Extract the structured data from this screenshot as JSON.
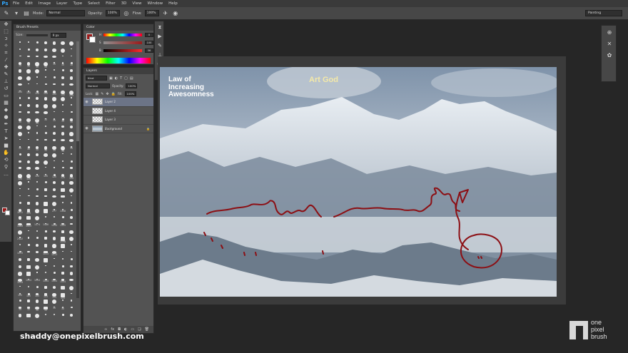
{
  "app": {
    "logo": "Ps"
  },
  "menu": [
    "File",
    "Edit",
    "Image",
    "Layer",
    "Type",
    "Select",
    "Filter",
    "3D",
    "View",
    "Window",
    "Help"
  ],
  "options": {
    "mode_label": "Mode:",
    "mode_value": "Normal",
    "opacity_label": "Opacity:",
    "opacity_value": "100%",
    "flow_label": "Flow:",
    "flow_value": "100%",
    "workspace": "Painting"
  },
  "brush_panel": {
    "tab": "Brush Presets",
    "size_label": "Size:",
    "size_value": "9 px",
    "rows": [
      [
        "",
        "",
        "",
        "",
        "",
        "",
        ""
      ],
      [
        "",
        "",
        "",
        "",
        "",
        "",
        ""
      ],
      [
        "",
        "",
        "",
        "",
        "",
        "",
        ""
      ],
      [
        "10",
        "10",
        "10",
        "10",
        "10",
        "10",
        "10"
      ],
      [
        "",
        "",
        "",
        "",
        "",
        "",
        ""
      ],
      [
        "",
        "",
        "",
        "",
        "",
        "",
        ""
      ],
      [
        "",
        "",
        "",
        "",
        "",
        "",
        ""
      ],
      [
        "100",
        "100",
        "100",
        "100",
        "100",
        "100",
        "100"
      ],
      [
        "",
        "",
        "",
        "",
        "",
        "",
        ""
      ],
      [
        "",
        "",
        "",
        "",
        "",
        "",
        ""
      ],
      [
        "",
        "",
        "",
        "",
        "",
        "",
        ""
      ],
      [
        "30",
        "30",
        "30",
        "30",
        "30",
        "30",
        "30"
      ],
      [
        "",
        "",
        "",
        "",
        "",
        "",
        ""
      ],
      [
        "",
        "",
        "",
        "",
        "",
        "",
        ""
      ],
      [
        "",
        "",
        "",
        "",
        "",
        "",
        ""
      ],
      [
        "30",
        "30",
        "30",
        "30",
        "30",
        "30",
        "30"
      ],
      [
        "",
        "",
        "",
        "",
        "",
        "",
        ""
      ],
      [
        "",
        "",
        "",
        "",
        "",
        "",
        ""
      ],
      [
        "",
        "",
        "",
        "",
        "",
        "",
        ""
      ],
      [
        "120",
        "120",
        "120",
        "120",
        "120",
        "120",
        "120"
      ],
      [
        "",
        "",
        "",
        "",
        "",
        "",
        ""
      ],
      [
        "",
        "",
        "",
        "",
        "",
        "",
        ""
      ],
      [
        "",
        "",
        "",
        "",
        "",
        "",
        ""
      ],
      [
        "",
        "",
        "",
        "",
        "",
        "",
        ""
      ],
      [
        "1651",
        "325",
        "",
        "",
        "277",
        "1448",
        ""
      ],
      [
        "",
        "",
        "",
        "",
        "",
        "",
        ""
      ],
      [
        "1469",
        "1413",
        "1474",
        "1486",
        "1450",
        "1445",
        ""
      ],
      [
        "",
        "",
        "",
        "",
        "",
        "",
        ""
      ],
      [
        "2422",
        "",
        "",
        "",
        "",
        "2098",
        ""
      ],
      [
        "",
        "",
        "",
        "",
        "",
        "",
        ""
      ],
      [
        "1013",
        "",
        "",
        "1013",
        "1013",
        "",
        ""
      ],
      [
        "",
        "",
        "",
        "",
        "",
        "",
        ""
      ],
      [
        "",
        "",
        "",
        "",
        "",
        "",
        ""
      ],
      [
        "",
        "",
        "",
        "",
        "",
        "",
        ""
      ],
      [
        "1004",
        "1004",
        "1004",
        "1004",
        "1004",
        "1004",
        ""
      ],
      [
        "",
        "",
        "",
        "",
        "",
        "",
        ""
      ],
      [
        "105",
        "105",
        "105",
        "105",
        "105",
        "105",
        ""
      ],
      [
        "",
        "",
        "",
        "",
        "",
        "",
        ""
      ],
      [
        "30",
        "30",
        "30",
        "30",
        "30",
        "30",
        ""
      ],
      [
        "",
        "",
        "",
        "",
        "",
        "",
        ""
      ]
    ]
  },
  "color_panel": {
    "tab": "Color",
    "sliders": [
      {
        "label": "H",
        "value": "0"
      },
      {
        "label": "S",
        "value": "100"
      },
      {
        "label": "B",
        "value": "56"
      }
    ]
  },
  "layers_panel": {
    "tab": "Layers",
    "filter_value": "Kind",
    "blend_value": "Normal",
    "opacity_label": "Opacity:",
    "opacity_value": "100%",
    "lock_label": "Lock:",
    "fill_label": "Fill:",
    "fill_value": "100%",
    "layers": [
      {
        "name": "Layer 2",
        "selected": true,
        "type": "pixel"
      },
      {
        "name": "Layer 4",
        "selected": false,
        "type": "pixel"
      },
      {
        "name": "Layer 3",
        "selected": false,
        "type": "pixel"
      },
      {
        "name": "Background",
        "selected": false,
        "type": "photo"
      }
    ]
  },
  "document": {
    "title_lines": [
      "Law of",
      "Increasing",
      "Awesomness"
    ],
    "art_god": "Art God"
  },
  "watermark": {
    "author": "shaddy@onepixelbrush.com",
    "logo_words": [
      "one",
      "pixel",
      "brush"
    ]
  },
  "colors": {
    "stroke": "#8c0f14",
    "foreground": "#9b1a1a",
    "background": "#ffffff",
    "layer_selected": "#6c7487"
  }
}
